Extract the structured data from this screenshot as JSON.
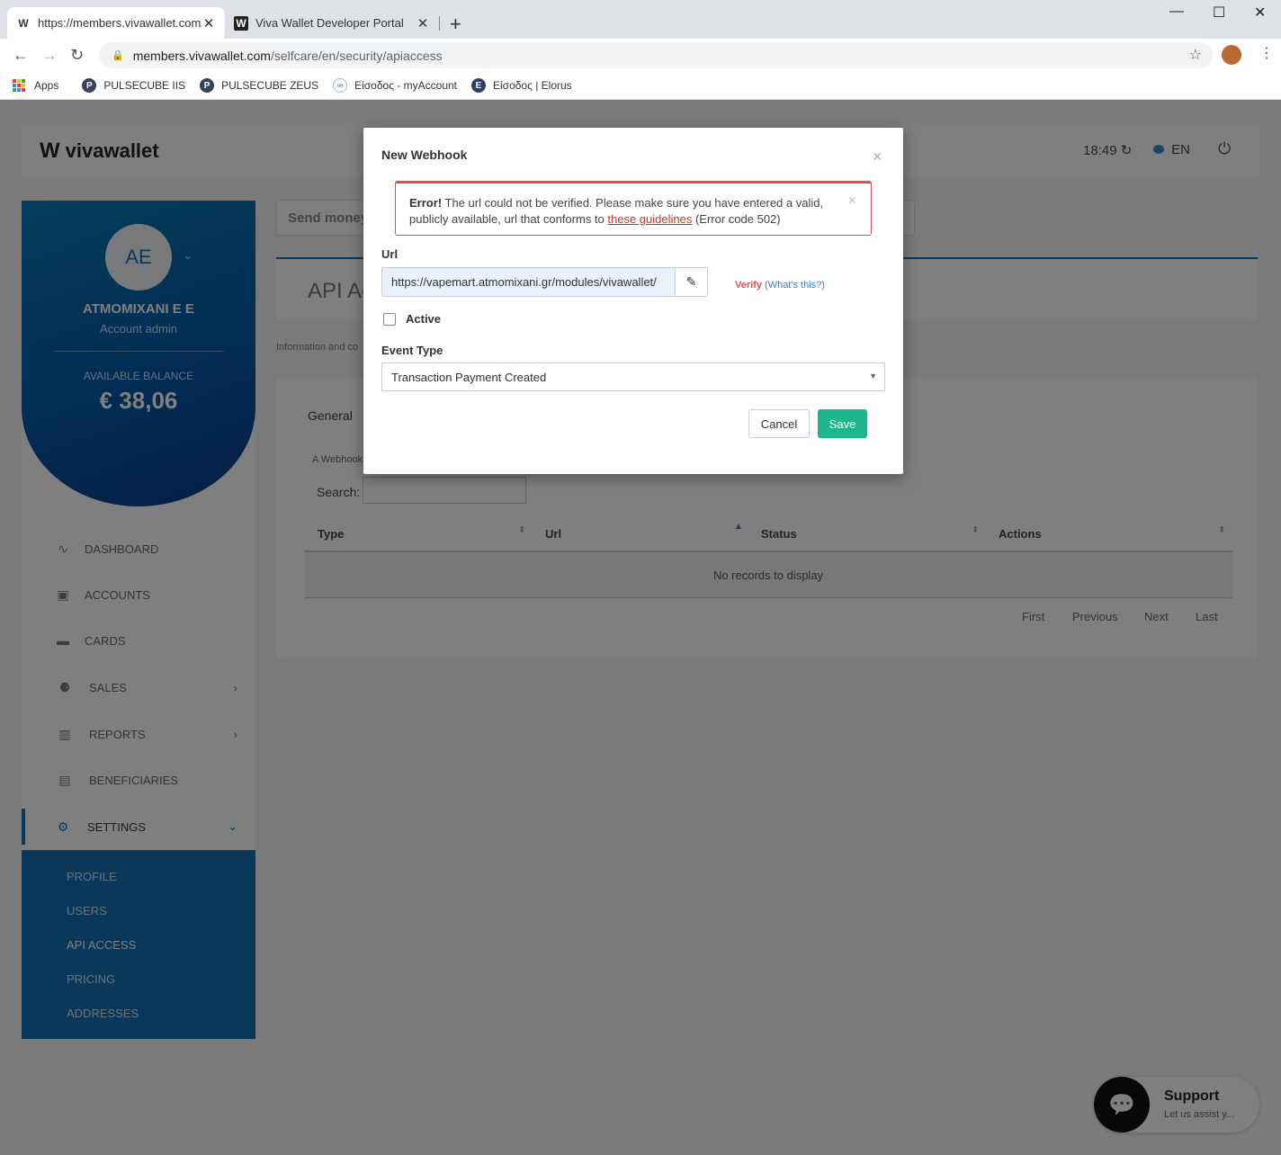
{
  "browser": {
    "tabs": [
      {
        "title": "https://members.vivawallet.com/"
      },
      {
        "title": "Viva Wallet Developer Portal"
      }
    ],
    "address": {
      "host": "members.vivawallet.com",
      "path": "/selfcare/en/security/apiaccess"
    },
    "bookmarks": [
      {
        "label": "Apps"
      },
      {
        "label": "PULSECUBE IIS"
      },
      {
        "label": "PULSECUBE ZEUS"
      },
      {
        "label": "Είσοδος - myAccount"
      },
      {
        "label": "Είσοδος | Elorus"
      }
    ]
  },
  "header": {
    "logo": "vivawallet",
    "time": "18:49",
    "lang": "EN"
  },
  "profile": {
    "initials": "AE",
    "company": "ATMOMIXANI E E",
    "role": "Account admin",
    "balance_label": "AVAILABLE BALANCE",
    "balance": "€ 38,06"
  },
  "nav": [
    {
      "label": "DASHBOARD"
    },
    {
      "label": "ACCOUNTS"
    },
    {
      "label": "CARDS"
    },
    {
      "label": "SALES"
    },
    {
      "label": "REPORTS"
    },
    {
      "label": "BENEFICIARIES"
    },
    {
      "label": "SETTINGS"
    }
  ],
  "settings_submenu": [
    {
      "label": "PROFILE"
    },
    {
      "label": "USERS"
    },
    {
      "label": "API ACCESS"
    },
    {
      "label": "PRICING"
    },
    {
      "label": "ADDRESSES"
    }
  ],
  "main": {
    "search_placeholder": "Send money",
    "page_title": "API Ac",
    "info_text": "Information and co",
    "tab_general": "General",
    "webhook_text": "A Webhook",
    "search_label": "Search:",
    "columns": [
      "Type",
      "Url",
      "Status",
      "Actions"
    ],
    "empty_text": "No records to display",
    "pager": [
      "First",
      "Previous",
      "Next",
      "Last"
    ]
  },
  "modal": {
    "title": "New Webhook",
    "error_label": "Error!",
    "error_text_1": " The url could not be verified. Please make sure you have entered a valid, publicly available, url that conforms to ",
    "error_link": "these guidelines",
    "error_text_2": " (Error code 502)",
    "url_label": "Url",
    "url_value": "https://vapemart.atmomixani.gr/modules/vivawallet/",
    "verify": "Verify",
    "whats_this": "(What's this?)",
    "active_label": "Active",
    "active_checked": false,
    "event_type_label": "Event Type",
    "event_type_value": "Transaction Payment Created",
    "cancel": "Cancel",
    "save": "Save"
  },
  "support": {
    "title": "Support",
    "subtitle": "Let us assist y..."
  },
  "colors": {
    "brand_blue": "#1270b5",
    "save_green": "#1fb489",
    "error_red": "#e04b4b"
  }
}
